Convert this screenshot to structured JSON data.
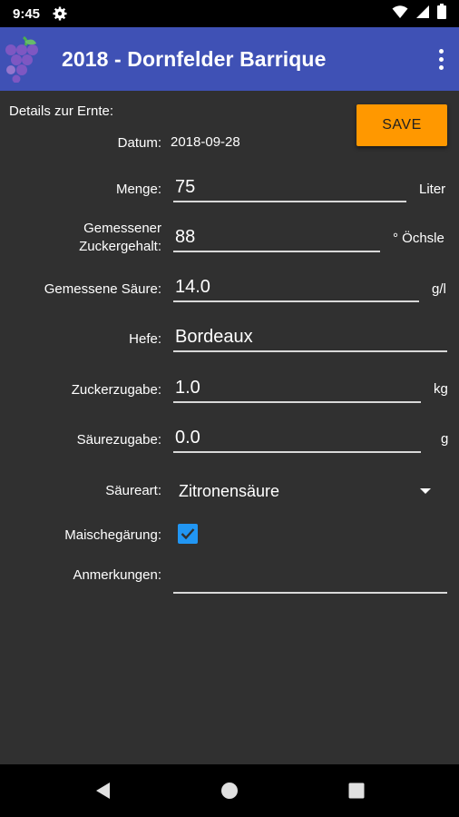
{
  "status_bar": {
    "time": "9:45",
    "icons": [
      "settings-icon",
      "wifi-icon",
      "signal-icon",
      "battery-icon"
    ]
  },
  "app_bar": {
    "title": "2018 - Dornfelder Barrique",
    "logo": "grape-icon",
    "menu_icon": "more-vert-icon",
    "color": "#3f51b5"
  },
  "form": {
    "section_title": "Details zur Ernte:",
    "save_label": "SAVE",
    "save_color": "#ff9800",
    "date": {
      "label": "Datum:",
      "value": "2018-09-28"
    },
    "amount": {
      "label": "Menge:",
      "value": "75",
      "unit": "Liter"
    },
    "sugar_measured": {
      "label_line1": "Gemessener",
      "label_line2": "Zuckergehalt:",
      "value": "88",
      "unit": "° Öchsle"
    },
    "acid_measured": {
      "label": "Gemessene Säure:",
      "value": "14.0",
      "unit": "g/l"
    },
    "yeast": {
      "label": "Hefe:",
      "value": "Bordeaux"
    },
    "sugar_added": {
      "label": "Zuckerzugabe:",
      "value": "1.0",
      "unit": "kg"
    },
    "acid_added": {
      "label": "Säurezugabe:",
      "value": "0.0",
      "unit": "g"
    },
    "acid_type": {
      "label": "Säureart:",
      "value": "Zitronensäure"
    },
    "mash_fermentation": {
      "label": "Maischegärung:",
      "checked": true,
      "color": "#2196f3"
    },
    "notes": {
      "label": "Anmerkungen:",
      "value": ""
    }
  },
  "nav_bar": {
    "icons": [
      "back-icon",
      "home-icon",
      "recents-icon"
    ]
  }
}
